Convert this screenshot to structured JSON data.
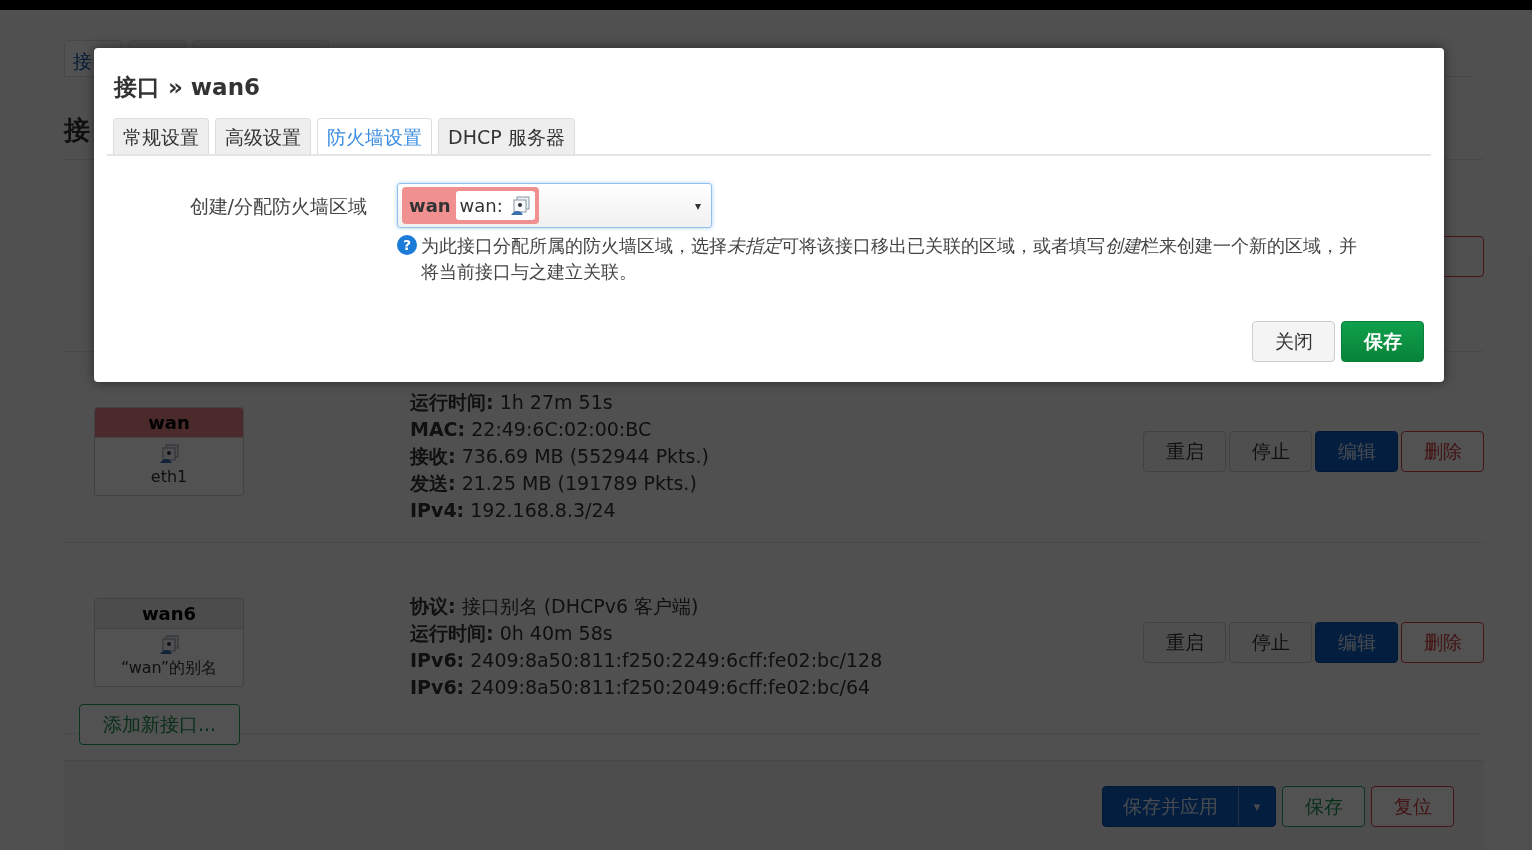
{
  "page": {
    "tab": {
      "label": "接",
      "selected": true
    },
    "heading": "接",
    "interfaces": [
      {
        "name": "wan",
        "color": "#4b2a2b",
        "device": "eth1",
        "details": [
          {
            "label": "运行时间:",
            "value": "1h 27m 51s"
          },
          {
            "label": "MAC:",
            "value": "22:49:6C:02:00:BC"
          },
          {
            "label": "接收:",
            "value": "736.69 MB (552944 Pkts.)"
          },
          {
            "label": "发送:",
            "value": "21.25 MB (191789 Pkts.)"
          },
          {
            "label": "IPv4:",
            "value": "192.168.8.3/24"
          }
        ],
        "actions": [
          {
            "label": "重启",
            "kind": "default"
          },
          {
            "label": "停止",
            "kind": "default"
          },
          {
            "label": "编辑",
            "kind": "primary"
          },
          {
            "label": "删除",
            "kind": "danger"
          }
        ]
      },
      {
        "name": "wan6",
        "color": "#4c4c4c",
        "device": "“wan”的别名",
        "details": [
          {
            "label": "协议:",
            "value": "接口别名 (DHCPv6 客户端)"
          },
          {
            "label": "运行时间:",
            "value": "0h 40m 58s"
          },
          {
            "label": "IPv6:",
            "value": "2409:8a50:811:f250:2249:6cff:fe02:bc/128"
          },
          {
            "label": "IPv6:",
            "value": "2409:8a50:811:f250:2049:6cff:fe02:bc/64"
          }
        ],
        "actions": [
          {
            "label": "重启",
            "kind": "default"
          },
          {
            "label": "停止",
            "kind": "default"
          },
          {
            "label": "编辑",
            "kind": "primary"
          },
          {
            "label": "删除",
            "kind": "danger"
          }
        ]
      }
    ],
    "add_button": "添加新接口...",
    "footer_buttons": [
      {
        "label": "保存并应用",
        "kind": "split",
        "caret": "▾"
      },
      {
        "label": "保存",
        "kind": "save"
      },
      {
        "label": "复位",
        "kind": "danger"
      }
    ]
  },
  "dialog": {
    "title": "接口 » wan6",
    "tabs": [
      {
        "label": "常规设置",
        "selected": false
      },
      {
        "label": "高级设置",
        "selected": false
      },
      {
        "label": "防火墙设置",
        "selected": true
      },
      {
        "label": "DHCP 服务器",
        "selected": false
      }
    ],
    "field": {
      "label": "创建/分配防火墙区域",
      "zone": {
        "name": "wan",
        "color": "#f09090",
        "networks": "wan:"
      },
      "caret": "▾",
      "help_mark": "?",
      "help": [
        {
          "text": "为此接口分配所属的防火墙区域，选择",
          "italic": false
        },
        {
          "text": "未指定",
          "italic": true
        },
        {
          "text": "可将该接口移出已关联的区域，或者填写",
          "italic": false
        },
        {
          "text": "创建",
          "italic": true
        },
        {
          "text": "栏来创建一个新的区域，并将当前接口与之建立关联。",
          "italic": false
        }
      ]
    },
    "buttons": [
      {
        "label": "关闭",
        "kind": "default"
      },
      {
        "label": "保存",
        "kind": "success"
      }
    ]
  }
}
